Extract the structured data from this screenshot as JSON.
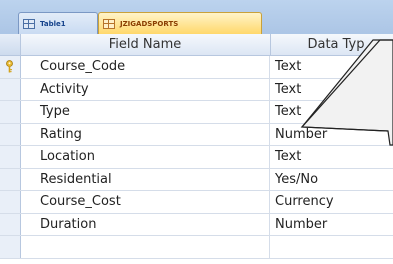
{
  "tabs": [
    {
      "label": "Table1",
      "active": false
    },
    {
      "label": "JZIGADSPORTS",
      "active": true
    }
  ],
  "columns": {
    "field_name": "Field Name",
    "data_type": "Data Typ"
  },
  "rows": [
    {
      "field": "Course_Code",
      "type": "Text",
      "primary_key": true
    },
    {
      "field": "Activity",
      "type": "Text"
    },
    {
      "field": "Type",
      "type": "Text"
    },
    {
      "field": "Rating",
      "type": "Number"
    },
    {
      "field": "Location",
      "type": "Text"
    },
    {
      "field": "Residential",
      "type": "Yes/No"
    },
    {
      "field": "Course_Cost",
      "type": "Currency"
    },
    {
      "field": "Duration",
      "type": "Number"
    }
  ],
  "icons": {
    "table_tab": "table-icon",
    "primary_key": "key-icon"
  },
  "colors": {
    "tab_active": "#ffd86b",
    "tab_inactive": "#c9dbf2",
    "header": "#dce6f4",
    "key": "#d4a21a"
  }
}
